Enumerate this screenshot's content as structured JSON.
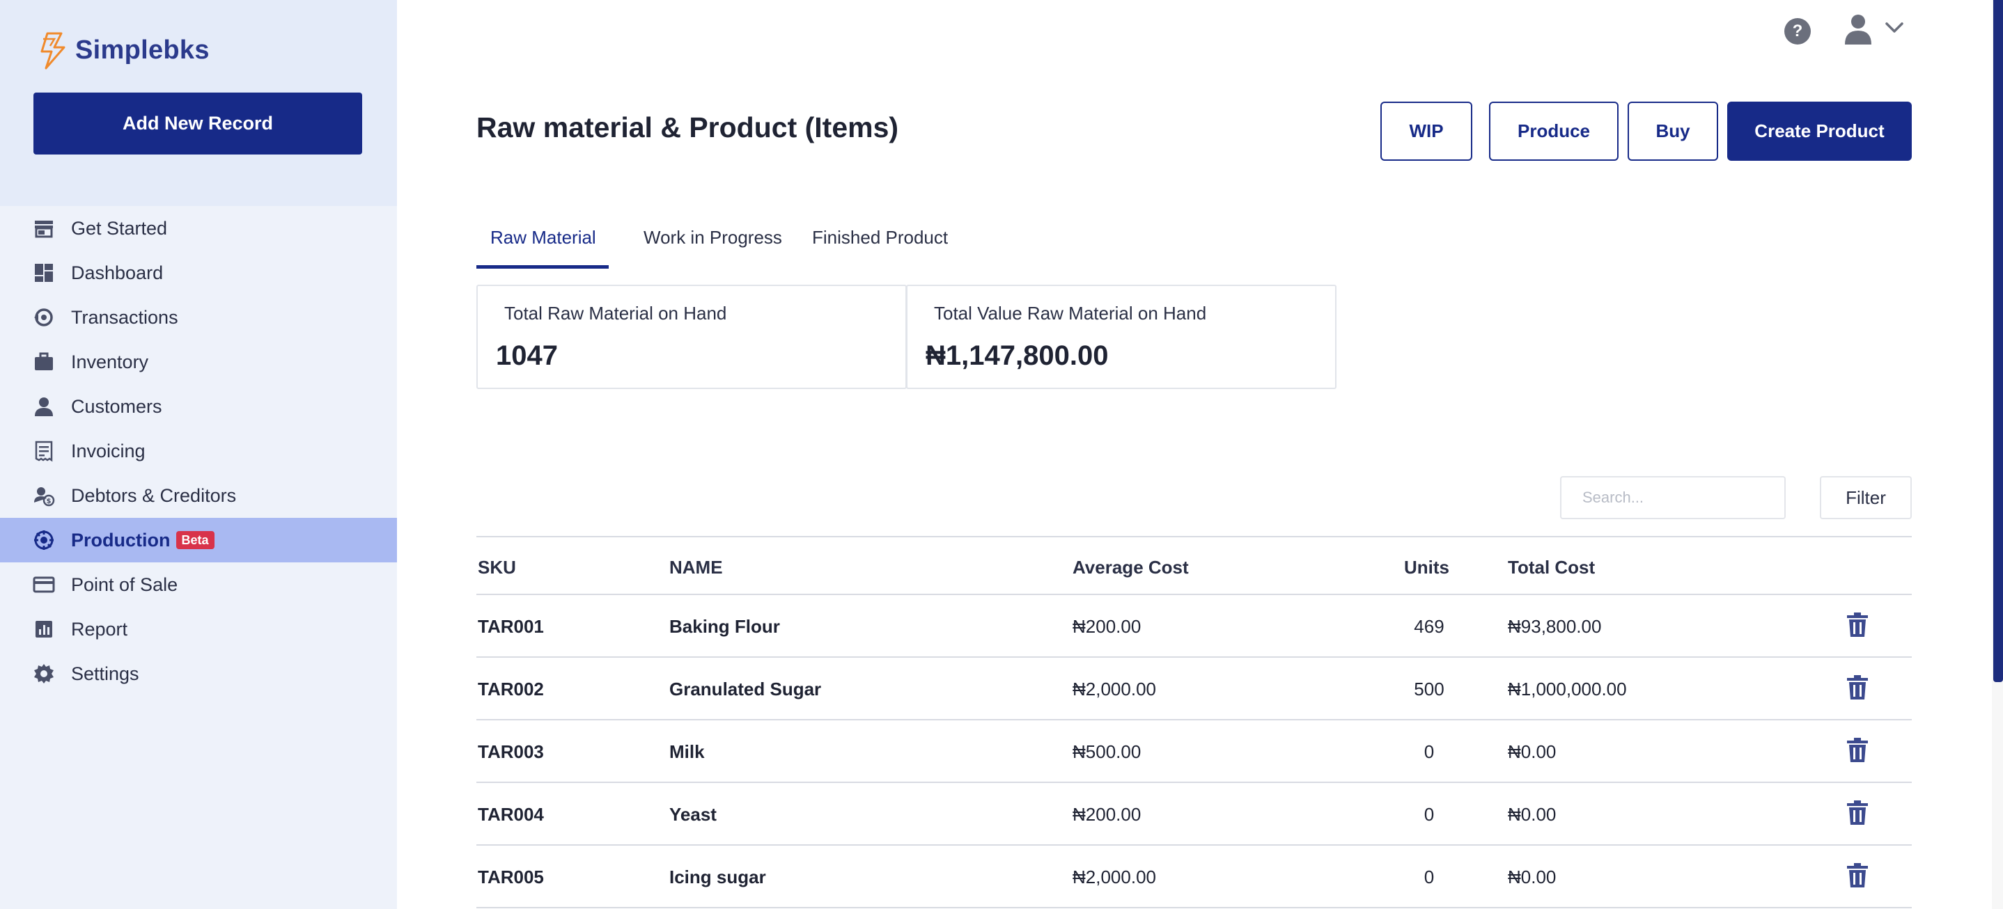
{
  "brand": {
    "name": "Simplebks",
    "accent": "#172a88",
    "logo_color": "#f08a2c"
  },
  "sidebar": {
    "add_button": "Add New Record",
    "items": [
      {
        "label": "Get Started",
        "icon": "store-icon"
      },
      {
        "label": "Dashboard",
        "icon": "dashboard-icon"
      },
      {
        "label": "Transactions",
        "icon": "transactions-icon"
      },
      {
        "label": "Inventory",
        "icon": "briefcase-icon"
      },
      {
        "label": "Customers",
        "icon": "person-icon"
      },
      {
        "label": "Invoicing",
        "icon": "receipt-icon"
      },
      {
        "label": "Debtors & Creditors",
        "icon": "debtors-icon"
      },
      {
        "label": "Production",
        "icon": "production-icon",
        "badge": "Beta",
        "active": true
      },
      {
        "label": "Point of Sale",
        "icon": "card-icon"
      },
      {
        "label": "Report",
        "icon": "report-icon"
      },
      {
        "label": "Settings",
        "icon": "gear-icon"
      }
    ]
  },
  "header": {
    "title": "Raw material & Product (Items)",
    "buttons": {
      "wip": "WIP",
      "produce": "Produce",
      "buy": "Buy",
      "create": "Create Product"
    },
    "help_glyph": "?"
  },
  "tabs": [
    {
      "label": "Raw Material",
      "active": true
    },
    {
      "label": "Work in Progress"
    },
    {
      "label": "Finished Product"
    }
  ],
  "stats": [
    {
      "label": "Total Raw Material on Hand",
      "value": "1047"
    },
    {
      "label": "Total Value Raw Material on Hand",
      "value": "₦1,147,800.00"
    }
  ],
  "toolbar": {
    "search_placeholder": "Search...",
    "filter_label": "Filter"
  },
  "table": {
    "columns": [
      "SKU",
      "NAME",
      "Average Cost",
      "Units",
      "Total Cost"
    ],
    "rows": [
      {
        "sku": "TAR001",
        "name": "Baking Flour",
        "avg_cost": "₦200.00",
        "units": "469",
        "total_cost": "₦93,800.00"
      },
      {
        "sku": "TAR002",
        "name": "Granulated Sugar",
        "avg_cost": "₦2,000.00",
        "units": "500",
        "total_cost": "₦1,000,000.00"
      },
      {
        "sku": "TAR003",
        "name": "Milk",
        "avg_cost": "₦500.00",
        "units": "0",
        "total_cost": "₦0.00"
      },
      {
        "sku": "TAR004",
        "name": "Yeast",
        "avg_cost": "₦200.00",
        "units": "0",
        "total_cost": "₦0.00"
      },
      {
        "sku": "TAR005",
        "name": "Icing sugar",
        "avg_cost": "₦2,000.00",
        "units": "0",
        "total_cost": "₦0.00"
      }
    ]
  }
}
